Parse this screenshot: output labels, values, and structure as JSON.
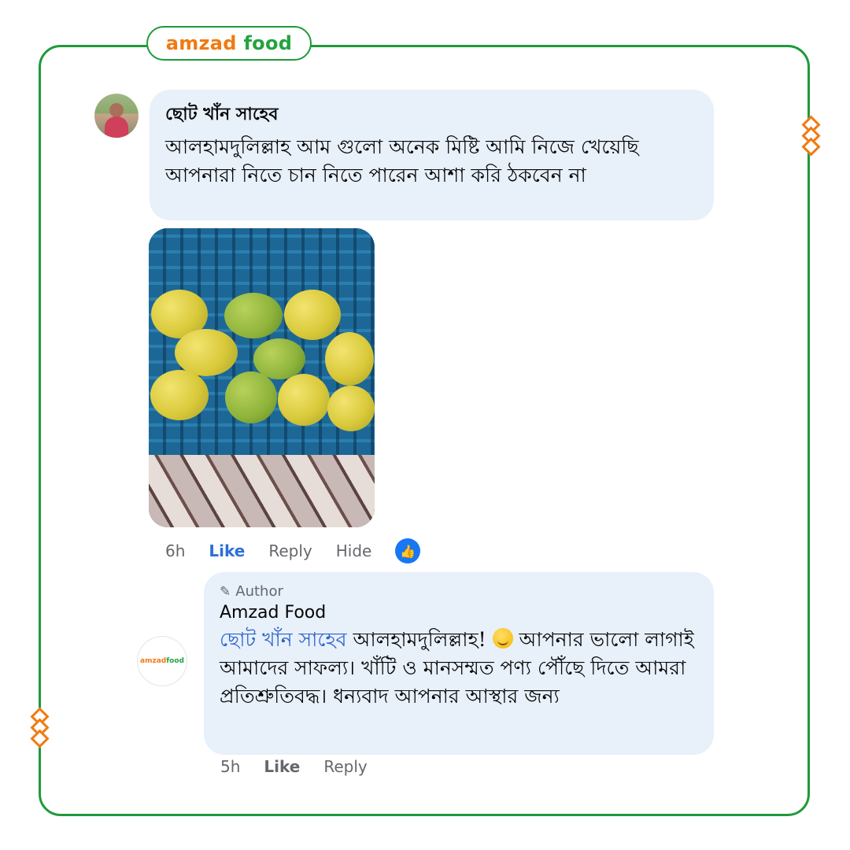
{
  "brand": {
    "name_part1": "amzad",
    "name_part2": "food",
    "accent": "#f07a12",
    "green": "#1f9a3a"
  },
  "comment": {
    "author": "ছোট খাঁন সাহেব",
    "text": "আলহামদুলিল্লাহ আম গুলো অনেক মিষ্টি আমি নিজে খেয়েছি আপনারা নিতে চান নিতে পারেন আশা করি ঠকবেন না",
    "photo_icon": "mango-crate-photo",
    "time": "6h",
    "like_label": "Like",
    "reply_label": "Reply",
    "hide_label": "Hide",
    "reaction_icon": "thumbs-up-icon"
  },
  "reply": {
    "badge_icon": "pencil-icon",
    "badge": "Author",
    "author": "Amzad Food",
    "mention": "ছোট খাঁন সাহেব",
    "text_part1": " আলহামদুলিল্লাহ! ",
    "emoji_icon": "smiling-face-emoji",
    "text_part2": " আপনার ভালো লাগাই আমাদের সাফল্য। খাঁটি ও মানসম্মত পণ্য পৌঁছে দিতে আমরা প্রতিশ্রুতিবদ্ধ। ধন্যবাদ আপনার আস্থার জন্য",
    "avatar_logo_part1": "amzad",
    "avatar_logo_part2": "food",
    "time": "5h",
    "like_label": "Like",
    "reply_label": "Reply"
  }
}
